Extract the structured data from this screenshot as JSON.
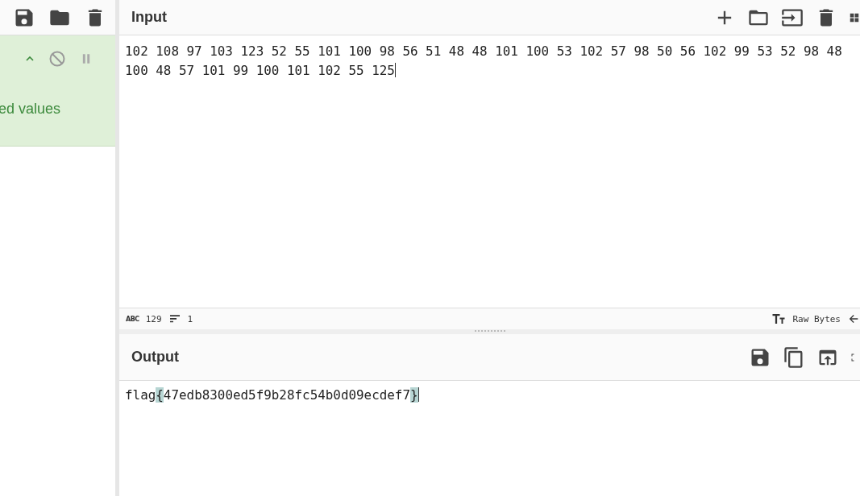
{
  "recipe": {
    "operation_fragment": "ed values",
    "enabled": true
  },
  "input": {
    "title": "Input",
    "lines": [
      "102 108 97 103 123 52 55 101 100 98 56 51 48 48 101 100 53 102 57 98 50 56 102 99 53 52 98 48",
      "100 48 57 101 99 100 101 102 55 125"
    ],
    "status": {
      "abc_badge": "ABC",
      "length": "129",
      "line_count": "1",
      "encoding": "Raw Bytes"
    }
  },
  "output": {
    "title": "Output",
    "segments": [
      {
        "text": "flag",
        "highlighted": false
      },
      {
        "text": "{",
        "highlighted": true
      },
      {
        "text": "47edb8300ed5f9b28fc54b0d09ecdef7",
        "highlighted": false
      },
      {
        "text": "}",
        "highlighted": true
      }
    ]
  }
}
